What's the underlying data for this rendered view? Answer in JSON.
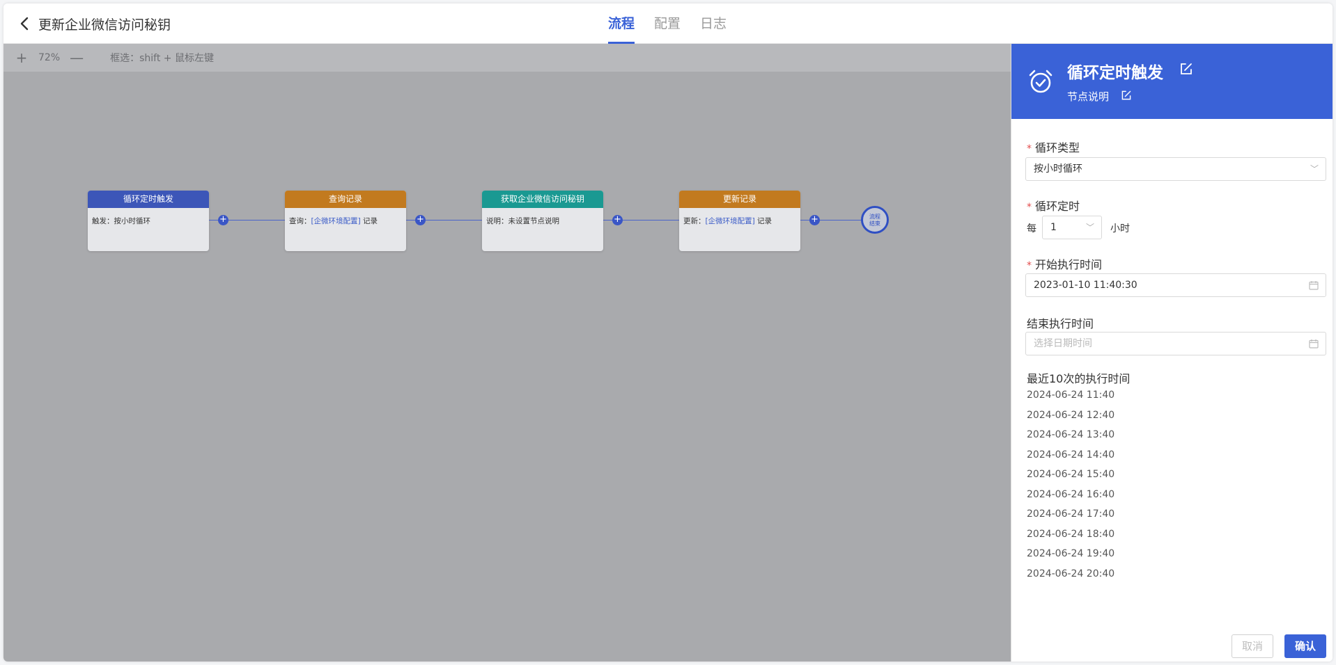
{
  "header": {
    "title": "更新企业微信访问秘钥",
    "tabs": [
      {
        "label": "流程",
        "active": true
      },
      {
        "label": "配置",
        "active": false
      },
      {
        "label": "日志",
        "active": false
      }
    ]
  },
  "toolbar": {
    "zoom": "72%",
    "hint": "框选：shift + 鼠标左键"
  },
  "flow": {
    "nodes": [
      {
        "title": "循环定时触发",
        "label": "触发：",
        "value": "按小时循环",
        "link": ""
      },
      {
        "title": "查询记录",
        "label": "查询：",
        "link": "[企微环境配置]",
        "value": " 记录"
      },
      {
        "title": "获取企业微信访问秘钥",
        "label": "说明：",
        "value": "未设置节点说明",
        "link": ""
      },
      {
        "title": "更新记录",
        "label": "更新：",
        "link": "[企微环境配置]",
        "value": " 记录"
      }
    ],
    "end_line1": "流程",
    "end_line2": "结束"
  },
  "panel": {
    "title": "循环定时触发",
    "subtitle": "节点说明",
    "loop_type_label": "循环类型",
    "loop_type_value": "按小时循环",
    "loop_timer_label": "循环定时",
    "every": "每",
    "interval_value": "1",
    "unit": "小时",
    "start_label": "开始执行时间",
    "start_value": "2023-01-10 11:40:30",
    "end_label": "结束执行时间",
    "end_placeholder": "选择日期时间",
    "recent_title": "最近10次的执行时间",
    "recent_times": [
      "2024-06-24 11:40",
      "2024-06-24 12:40",
      "2024-06-24 13:40",
      "2024-06-24 14:40",
      "2024-06-24 15:40",
      "2024-06-24 16:40",
      "2024-06-24 17:40",
      "2024-06-24 18:40",
      "2024-06-24 19:40",
      "2024-06-24 20:40"
    ],
    "cancel_label": "取消",
    "confirm_label": "确认"
  },
  "colors": {
    "accent": "#3a62d7",
    "node_blue": "#3c56b8",
    "node_orange": "#c27a1f",
    "node_teal": "#1a9992",
    "required": "#e34d4d"
  },
  "icons": [
    "back-arrow-icon",
    "zoom-in-icon",
    "zoom-out-icon",
    "add-node-icon",
    "alarm-clock-icon",
    "edit-icon",
    "chevron-down-icon",
    "calendar-icon"
  ]
}
